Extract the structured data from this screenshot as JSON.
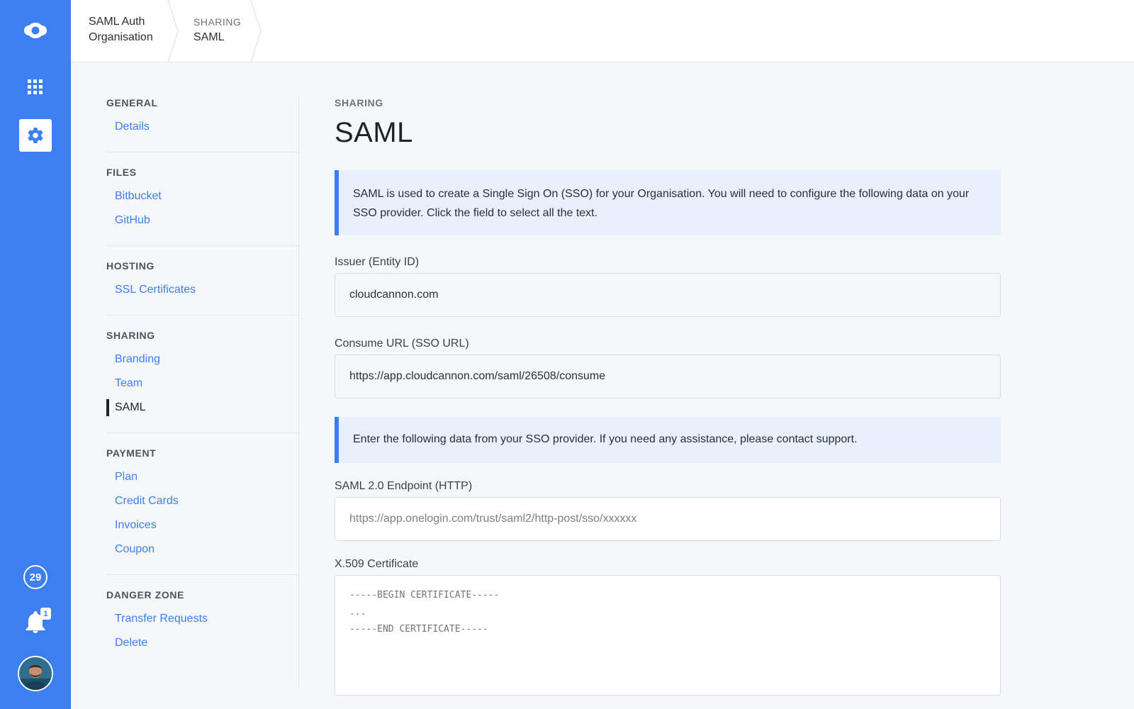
{
  "rail": {
    "logo_icon": "cloudcannon-logo-icon",
    "apps_icon": "grid-icon",
    "settings_icon": "gear-icon",
    "count": "29",
    "notifications_badge": "1",
    "accent": "#3b7ff0"
  },
  "breadcrumb": {
    "org_line1": "SAML Auth",
    "org_line2": "Organisation",
    "section_kicker": "SHARING",
    "section_label": "SAML"
  },
  "subnav": {
    "sections": [
      {
        "heading": "GENERAL",
        "links": [
          "Details"
        ]
      },
      {
        "heading": "FILES",
        "links": [
          "Bitbucket",
          "GitHub"
        ]
      },
      {
        "heading": "HOSTING",
        "links": [
          "SSL Certificates"
        ]
      },
      {
        "heading": "SHARING",
        "links": [
          "Branding",
          "Team",
          "SAML"
        ]
      },
      {
        "heading": "PAYMENT",
        "links": [
          "Plan",
          "Credit Cards",
          "Invoices",
          "Coupon"
        ]
      },
      {
        "heading": "DANGER ZONE",
        "links": [
          "Transfer Requests",
          "Delete"
        ]
      }
    ],
    "current": "SAML"
  },
  "main": {
    "kicker": "SHARING",
    "title": "SAML",
    "notice1": "SAML is used to create a Single Sign On (SSO) for your Organisation. You will need to configure the following data on your SSO provider. Click the field to select all the text.",
    "issuer_label": "Issuer (Entity ID)",
    "issuer_value": "cloudcannon.com",
    "consume_label": "Consume URL (SSO URL)",
    "consume_value": "https://app.cloudcannon.com/saml/26508/consume",
    "notice2": "Enter the following data from your SSO provider. If you need any assistance, please contact support.",
    "endpoint_label": "SAML 2.0 Endpoint (HTTP)",
    "endpoint_placeholder": "https://app.onelogin.com/trust/saml2/http-post/sso/xxxxxx",
    "cert_label": "X.509 Certificate",
    "cert_placeholder": "-----BEGIN CERTIFICATE-----\n...\n-----END CERTIFICATE-----"
  }
}
